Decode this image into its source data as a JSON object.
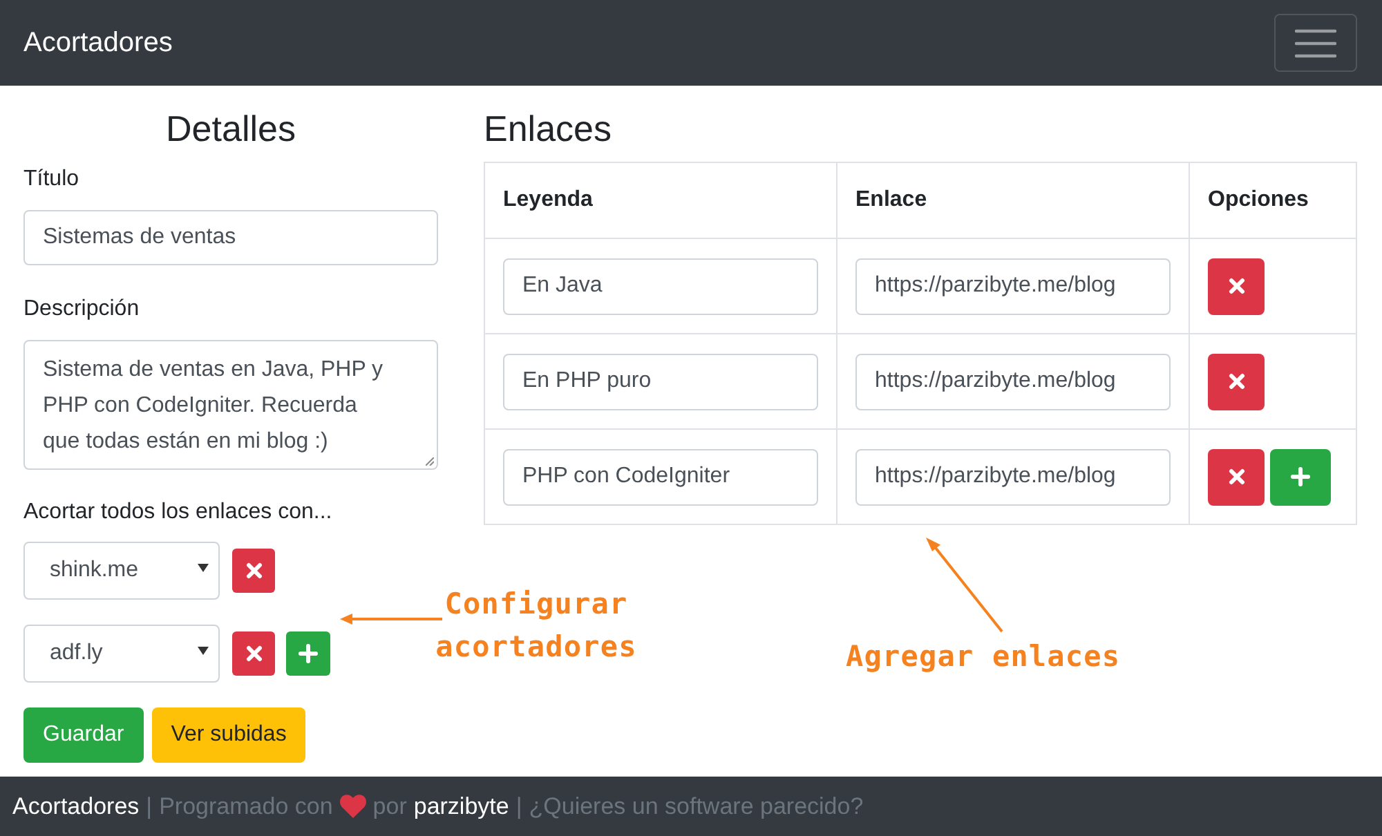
{
  "navbar": {
    "brand": "Acortadores"
  },
  "details": {
    "heading": "Detalles",
    "title_field": {
      "label": "Título",
      "value": "Sistemas de ventas"
    },
    "description_field": {
      "label": "Descripción",
      "value": "Sistema de ventas en Java, PHP y PHP con CodeIgniter. Recuerda que todas están en mi blog :)"
    },
    "shorteners": {
      "label": "Acortar todos los enlaces con...",
      "rows": [
        {
          "value": "shink.me",
          "actions": [
            {
              "kind": "remove"
            }
          ]
        },
        {
          "value": "adf.ly",
          "actions": [
            {
              "kind": "remove"
            },
            {
              "kind": "add"
            }
          ]
        }
      ],
      "annotation": "Configurar acortadores"
    },
    "buttons": [
      {
        "label": "Guardar",
        "kind": "success"
      },
      {
        "label": "Ver subidas",
        "kind": "warning"
      }
    ]
  },
  "links": {
    "heading": "Enlaces",
    "table": {
      "columns": [
        "Leyenda",
        "Enlace",
        "Opciones"
      ],
      "rows": [
        {
          "caption": "En Java",
          "url": "https://parzibyte.me/blog",
          "actions": [
            {
              "kind": "remove"
            }
          ]
        },
        {
          "caption": "En PHP puro",
          "url": "https://parzibyte.me/blog",
          "actions": [
            {
              "kind": "remove"
            }
          ]
        },
        {
          "caption": "PHP con CodeIgniter",
          "url": "https://parzibyte.me/blog",
          "actions": [
            {
              "kind": "remove"
            },
            {
              "kind": "add"
            }
          ]
        }
      ]
    },
    "annotation": "Agregar enlaces"
  },
  "footer": [
    {
      "kind": "brand",
      "text": "Acortadores"
    },
    {
      "kind": "separator",
      "text": "|"
    },
    {
      "kind": "text",
      "text": "Programado con"
    },
    {
      "kind": "heart"
    },
    {
      "kind": "text",
      "text": "por"
    },
    {
      "kind": "author",
      "text": "parzibyte"
    },
    {
      "kind": "separator",
      "text": "|"
    },
    {
      "kind": "link",
      "text": "¿Quieres un software parecido?"
    }
  ]
}
